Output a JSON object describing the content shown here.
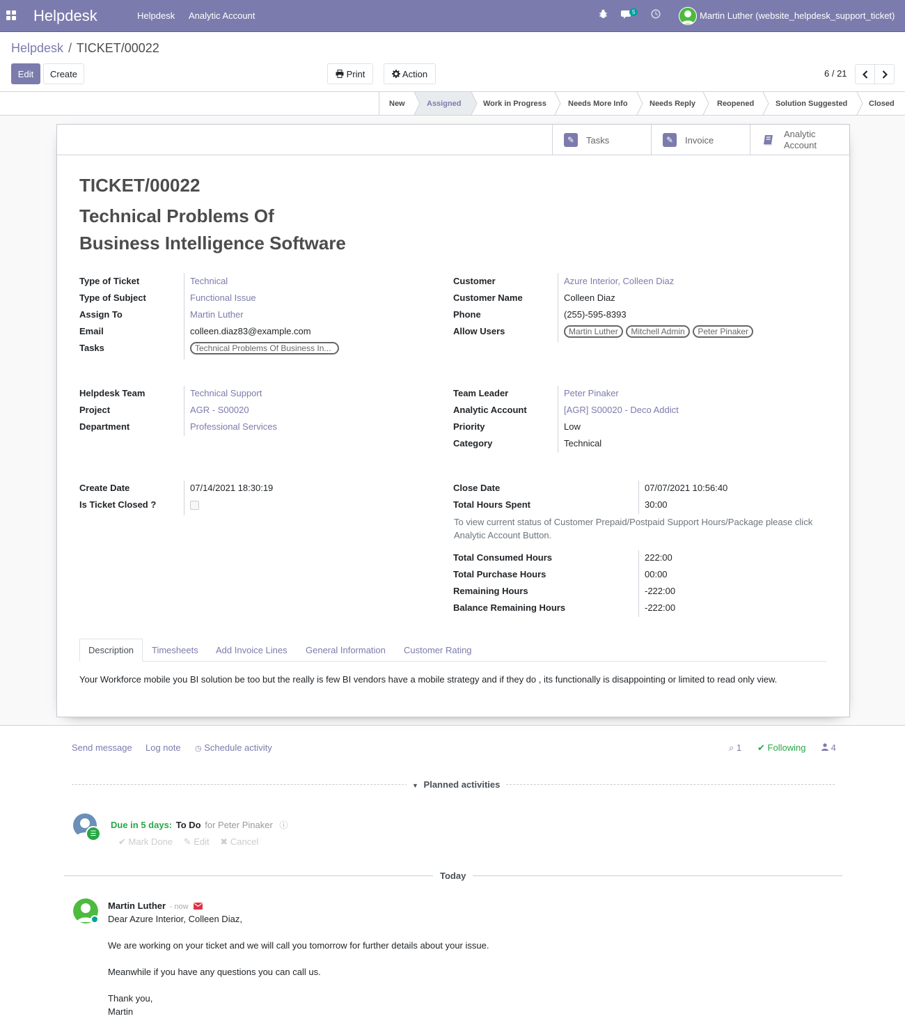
{
  "navbar": {
    "brand": "Helpdesk",
    "menus": [
      "Helpdesk",
      "Analytic Account"
    ],
    "message_count": "5",
    "user": "Martin Luther (website_helpdesk_support_ticket)"
  },
  "breadcrumb": {
    "parent": "Helpdesk",
    "separator": "/",
    "current": "TICKET/00022"
  },
  "buttons": {
    "edit": "Edit",
    "create": "Create",
    "print": "Print",
    "action": "Action"
  },
  "pager": {
    "value": "6 / 21"
  },
  "stages": [
    "New",
    "Assigned",
    "Work in Progress",
    "Needs More Info",
    "Needs Reply",
    "Reopened",
    "Solution Suggested",
    "Closed"
  ],
  "active_stage": "Assigned",
  "smart_buttons": {
    "tasks": "Tasks",
    "invoice": "Invoice",
    "analytic_line1": "Analytic",
    "analytic_line2": "Account"
  },
  "ticket": {
    "number": "TICKET/00022",
    "title_line1": "Technical Problems Of",
    "title_line2": "Business Intelligence Software"
  },
  "labels": {
    "type_of_ticket": "Type of Ticket",
    "type_of_subject": "Type of Subject",
    "assign_to": "Assign To",
    "email": "Email",
    "tasks": "Tasks",
    "customer": "Customer",
    "customer_name": "Customer Name",
    "phone": "Phone",
    "allow_users": "Allow Users",
    "helpdesk_team": "Helpdesk Team",
    "project": "Project",
    "department": "Department",
    "team_leader": "Team Leader",
    "analytic_account": "Analytic Account",
    "priority": "Priority",
    "category": "Category",
    "create_date": "Create Date",
    "is_ticket_closed": "Is Ticket Closed ?",
    "close_date": "Close Date",
    "total_hours_spent": "Total Hours Spent",
    "total_consumed_hours": "Total Consumed Hours",
    "total_purchase_hours": "Total Purchase Hours",
    "remaining_hours": "Remaining Hours",
    "balance_remaining_hours": "Balance Remaining Hours"
  },
  "values": {
    "type_of_ticket": "Technical",
    "type_of_subject": "Functional Issue",
    "assign_to": "Martin Luther",
    "email": "colleen.diaz83@example.com",
    "task_tag": "Technical Problems Of Business In...",
    "customer": "Azure Interior, Colleen Diaz",
    "customer_name": "Colleen Diaz",
    "phone": "(255)-595-8393",
    "allow_users": [
      "Martin Luther",
      "Mitchell Admin",
      "Peter Pinaker"
    ],
    "helpdesk_team": "Technical Support",
    "project": "AGR - S00020",
    "department": "Professional Services",
    "team_leader": "Peter Pinaker",
    "analytic_account": "[AGR] S00020 - Deco Addict",
    "priority": "Low",
    "category": "Technical",
    "create_date": "07/14/2021 18:30:19",
    "is_ticket_closed": false,
    "close_date": "07/07/2021 10:56:40",
    "total_hours_spent": "30:00",
    "total_consumed_hours": "222:00",
    "total_purchase_hours": "00:00",
    "remaining_hours": "-222:00",
    "balance_remaining_hours": "-222:00"
  },
  "help_text": "To view current status of Customer Prepaid/Postpaid Support Hours/Package please click Analytic Account Button.",
  "tabs": [
    "Description",
    "Timesheets",
    "Add Invoice Lines",
    "General Information",
    "Customer Rating"
  ],
  "description": "Your Workforce mobile  you BI solution be too but the really is few BI vendors have a mobile strategy and if they do , its functionally is disappointing or limited to read only view.",
  "chatter": {
    "send_message": "Send message",
    "log_note": "Log note",
    "schedule_activity": "Schedule activity",
    "attachments": "1",
    "following": "Following",
    "followers": "4",
    "planned_activities": "Planned activities",
    "activity": {
      "due": "Due in 5 days:",
      "type": "To Do",
      "for": "for Peter Pinaker",
      "mark_done": "Mark Done",
      "edit": "Edit",
      "cancel": "Cancel"
    },
    "today": "Today",
    "message": {
      "author": "Martin Luther",
      "time": "- now",
      "lines": [
        "Dear Azure Interior, Colleen Diaz,",
        "We are working on your ticket and we will call you tomorrow for further details about your issue.",
        "Meanwhile if you have any questions you can call us.",
        "Thank you,",
        "Martin"
      ]
    }
  },
  "colors": {
    "brand": "#7c7bad",
    "success": "#28a745",
    "danger": "#dc3545"
  }
}
